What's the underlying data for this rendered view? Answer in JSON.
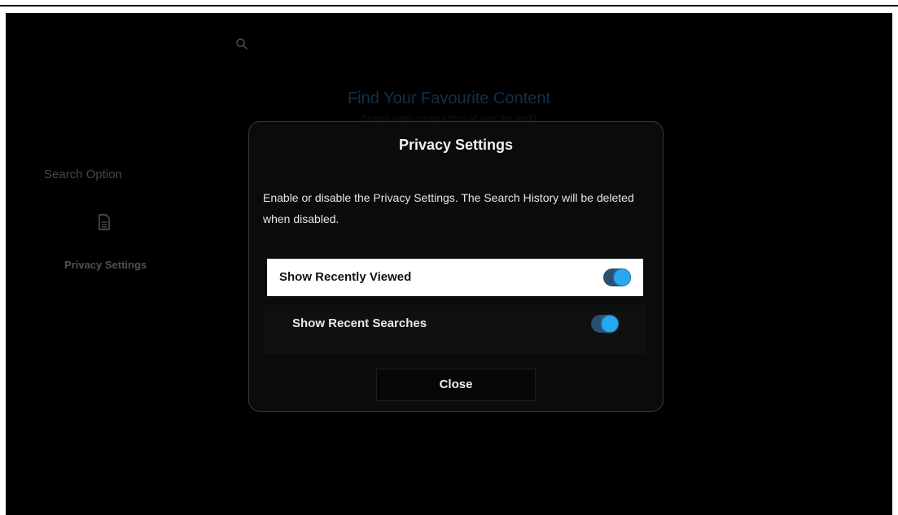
{
  "background": {
    "search_icon": "search-icon",
    "title": "Find Your Favourite Content",
    "subtitle": "Search video content from all over the world"
  },
  "sidebar": {
    "title": "Search Option",
    "items": [
      {
        "icon": "document-icon",
        "label": "Privacy Settings"
      }
    ]
  },
  "modal": {
    "title": "Privacy Settings",
    "description": "Enable or disable the Privacy Settings. The Search History will be deleted when disabled.",
    "options": [
      {
        "label": "Show Recently Viewed",
        "enabled": true,
        "focused": true
      },
      {
        "label": "Show Recent Searches",
        "enabled": true,
        "focused": false
      }
    ],
    "close_label": "Close"
  },
  "colors": {
    "accent": "#27a9f2",
    "toggle_track": "#2b4f6e",
    "focus_row": "#ffffff"
  }
}
